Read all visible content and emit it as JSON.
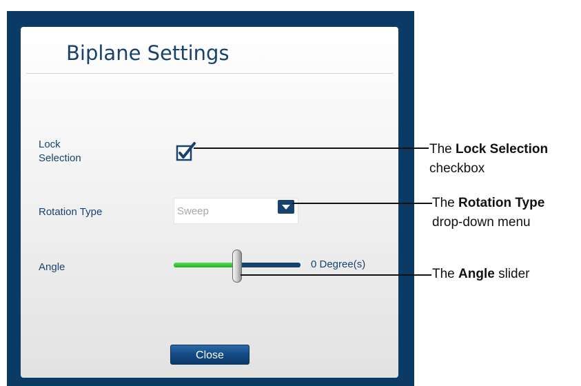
{
  "dialog": {
    "title": "Biplane Settings",
    "lock_selection": {
      "label_line1": "Lock",
      "label_line2": "Selection",
      "checked": true
    },
    "rotation_type": {
      "label": "Rotation Type",
      "value": "Sweep"
    },
    "angle": {
      "label": "Angle",
      "value_text": "0 Degree(s)",
      "slider_fraction": 0.5
    },
    "close_label": "Close"
  },
  "callouts": {
    "lock": {
      "prefix": "The ",
      "bold": "Lock Selection",
      "suffix": "checkbox"
    },
    "rotation": {
      "prefix": "The ",
      "bold": "Rotation Type",
      "suffix": "drop-down menu"
    },
    "angle": {
      "prefix": "The ",
      "bold": "Angle",
      "suffix": " slider"
    }
  },
  "colors": {
    "frame": "#0b3a64",
    "label_text": "#17426e",
    "slider_fill": "#2fc12f",
    "button": "#134a85"
  }
}
